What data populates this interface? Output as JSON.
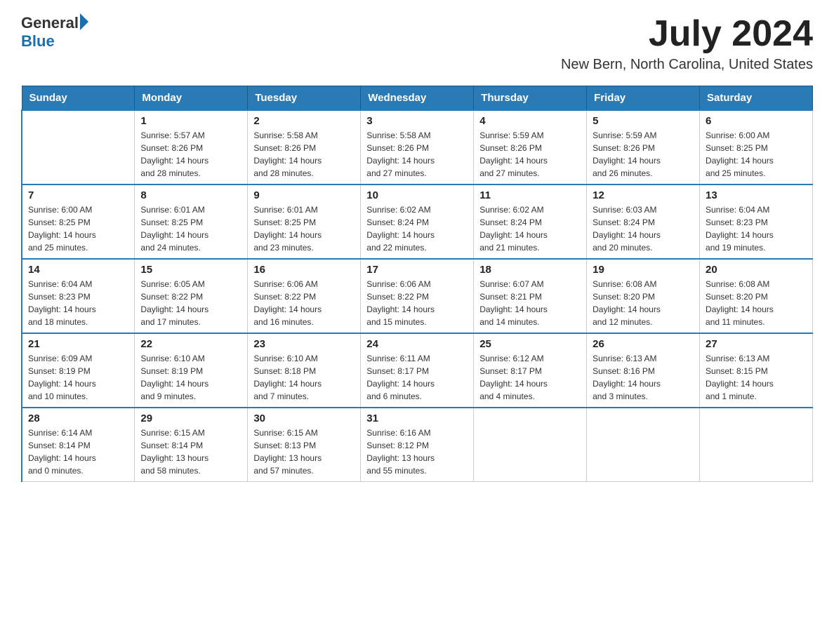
{
  "header": {
    "logo_general": "General",
    "logo_blue": "Blue",
    "month_year": "July 2024",
    "location": "New Bern, North Carolina, United States"
  },
  "days_of_week": [
    "Sunday",
    "Monday",
    "Tuesday",
    "Wednesday",
    "Thursday",
    "Friday",
    "Saturday"
  ],
  "weeks": [
    [
      {
        "day": "",
        "info": ""
      },
      {
        "day": "1",
        "info": "Sunrise: 5:57 AM\nSunset: 8:26 PM\nDaylight: 14 hours\nand 28 minutes."
      },
      {
        "day": "2",
        "info": "Sunrise: 5:58 AM\nSunset: 8:26 PM\nDaylight: 14 hours\nand 28 minutes."
      },
      {
        "day": "3",
        "info": "Sunrise: 5:58 AM\nSunset: 8:26 PM\nDaylight: 14 hours\nand 27 minutes."
      },
      {
        "day": "4",
        "info": "Sunrise: 5:59 AM\nSunset: 8:26 PM\nDaylight: 14 hours\nand 27 minutes."
      },
      {
        "day": "5",
        "info": "Sunrise: 5:59 AM\nSunset: 8:26 PM\nDaylight: 14 hours\nand 26 minutes."
      },
      {
        "day": "6",
        "info": "Sunrise: 6:00 AM\nSunset: 8:25 PM\nDaylight: 14 hours\nand 25 minutes."
      }
    ],
    [
      {
        "day": "7",
        "info": "Sunrise: 6:00 AM\nSunset: 8:25 PM\nDaylight: 14 hours\nand 25 minutes."
      },
      {
        "day": "8",
        "info": "Sunrise: 6:01 AM\nSunset: 8:25 PM\nDaylight: 14 hours\nand 24 minutes."
      },
      {
        "day": "9",
        "info": "Sunrise: 6:01 AM\nSunset: 8:25 PM\nDaylight: 14 hours\nand 23 minutes."
      },
      {
        "day": "10",
        "info": "Sunrise: 6:02 AM\nSunset: 8:24 PM\nDaylight: 14 hours\nand 22 minutes."
      },
      {
        "day": "11",
        "info": "Sunrise: 6:02 AM\nSunset: 8:24 PM\nDaylight: 14 hours\nand 21 minutes."
      },
      {
        "day": "12",
        "info": "Sunrise: 6:03 AM\nSunset: 8:24 PM\nDaylight: 14 hours\nand 20 minutes."
      },
      {
        "day": "13",
        "info": "Sunrise: 6:04 AM\nSunset: 8:23 PM\nDaylight: 14 hours\nand 19 minutes."
      }
    ],
    [
      {
        "day": "14",
        "info": "Sunrise: 6:04 AM\nSunset: 8:23 PM\nDaylight: 14 hours\nand 18 minutes."
      },
      {
        "day": "15",
        "info": "Sunrise: 6:05 AM\nSunset: 8:22 PM\nDaylight: 14 hours\nand 17 minutes."
      },
      {
        "day": "16",
        "info": "Sunrise: 6:06 AM\nSunset: 8:22 PM\nDaylight: 14 hours\nand 16 minutes."
      },
      {
        "day": "17",
        "info": "Sunrise: 6:06 AM\nSunset: 8:22 PM\nDaylight: 14 hours\nand 15 minutes."
      },
      {
        "day": "18",
        "info": "Sunrise: 6:07 AM\nSunset: 8:21 PM\nDaylight: 14 hours\nand 14 minutes."
      },
      {
        "day": "19",
        "info": "Sunrise: 6:08 AM\nSunset: 8:20 PM\nDaylight: 14 hours\nand 12 minutes."
      },
      {
        "day": "20",
        "info": "Sunrise: 6:08 AM\nSunset: 8:20 PM\nDaylight: 14 hours\nand 11 minutes."
      }
    ],
    [
      {
        "day": "21",
        "info": "Sunrise: 6:09 AM\nSunset: 8:19 PM\nDaylight: 14 hours\nand 10 minutes."
      },
      {
        "day": "22",
        "info": "Sunrise: 6:10 AM\nSunset: 8:19 PM\nDaylight: 14 hours\nand 9 minutes."
      },
      {
        "day": "23",
        "info": "Sunrise: 6:10 AM\nSunset: 8:18 PM\nDaylight: 14 hours\nand 7 minutes."
      },
      {
        "day": "24",
        "info": "Sunrise: 6:11 AM\nSunset: 8:17 PM\nDaylight: 14 hours\nand 6 minutes."
      },
      {
        "day": "25",
        "info": "Sunrise: 6:12 AM\nSunset: 8:17 PM\nDaylight: 14 hours\nand 4 minutes."
      },
      {
        "day": "26",
        "info": "Sunrise: 6:13 AM\nSunset: 8:16 PM\nDaylight: 14 hours\nand 3 minutes."
      },
      {
        "day": "27",
        "info": "Sunrise: 6:13 AM\nSunset: 8:15 PM\nDaylight: 14 hours\nand 1 minute."
      }
    ],
    [
      {
        "day": "28",
        "info": "Sunrise: 6:14 AM\nSunset: 8:14 PM\nDaylight: 14 hours\nand 0 minutes."
      },
      {
        "day": "29",
        "info": "Sunrise: 6:15 AM\nSunset: 8:14 PM\nDaylight: 13 hours\nand 58 minutes."
      },
      {
        "day": "30",
        "info": "Sunrise: 6:15 AM\nSunset: 8:13 PM\nDaylight: 13 hours\nand 57 minutes."
      },
      {
        "day": "31",
        "info": "Sunrise: 6:16 AM\nSunset: 8:12 PM\nDaylight: 13 hours\nand 55 minutes."
      },
      {
        "day": "",
        "info": ""
      },
      {
        "day": "",
        "info": ""
      },
      {
        "day": "",
        "info": ""
      }
    ]
  ]
}
